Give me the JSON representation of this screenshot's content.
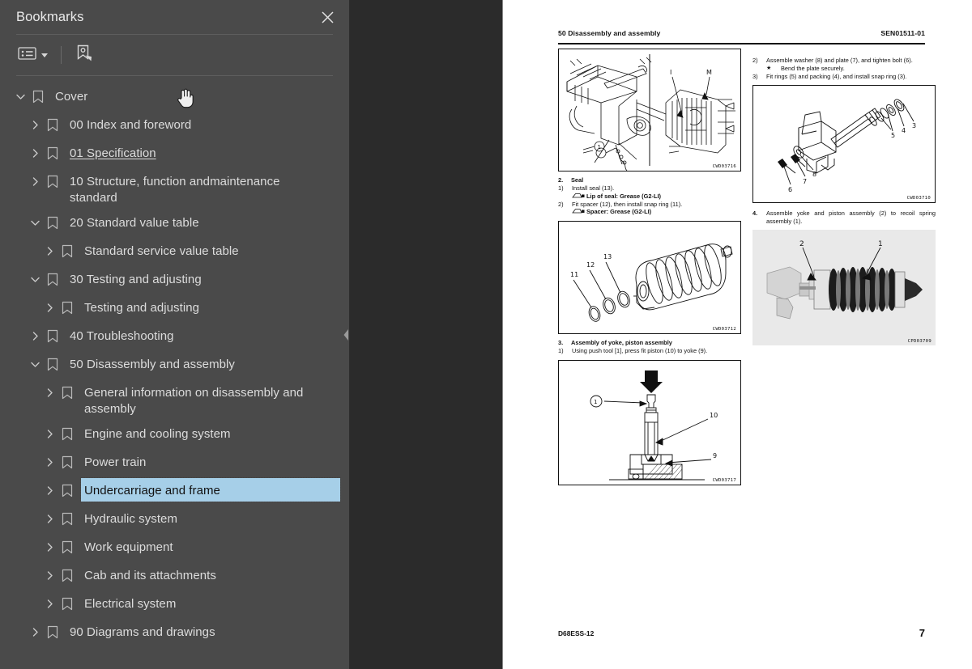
{
  "panel": {
    "title": "Bookmarks",
    "close_icon": "close-icon",
    "toolbar": {
      "list_options_label": "list-options",
      "list_options_icon": "bookmark-list-icon",
      "new_bookmark_icon": "new-bookmark-icon"
    }
  },
  "tree": [
    {
      "label": "Cover",
      "depth": 0,
      "state": "expanded",
      "selected": false,
      "underline": false
    },
    {
      "label": "00 Index and foreword",
      "depth": 1,
      "state": "collapsed",
      "selected": false,
      "underline": false
    },
    {
      "label": "01 Specification",
      "depth": 1,
      "state": "collapsed",
      "selected": false,
      "underline": true
    },
    {
      "label": "10 Structure, function andmaintenance standard",
      "depth": 1,
      "state": "collapsed",
      "selected": false,
      "underline": false
    },
    {
      "label": "20 Standard value table",
      "depth": 1,
      "state": "expanded",
      "selected": false,
      "underline": false
    },
    {
      "label": "Standard service value table",
      "depth": 2,
      "state": "collapsed",
      "selected": false,
      "underline": false
    },
    {
      "label": "30 Testing and adjusting",
      "depth": 1,
      "state": "expanded",
      "selected": false,
      "underline": false
    },
    {
      "label": "Testing and adjusting",
      "depth": 2,
      "state": "collapsed",
      "selected": false,
      "underline": false
    },
    {
      "label": "40 Troubleshooting",
      "depth": 1,
      "state": "collapsed",
      "selected": false,
      "underline": false
    },
    {
      "label": "50 Disassembly and assembly",
      "depth": 1,
      "state": "expanded",
      "selected": false,
      "underline": false
    },
    {
      "label": "General information on disassembly and assembly",
      "depth": 2,
      "state": "collapsed",
      "selected": false,
      "underline": false
    },
    {
      "label": "Engine and cooling system",
      "depth": 2,
      "state": "collapsed",
      "selected": false,
      "underline": false
    },
    {
      "label": "Power train",
      "depth": 2,
      "state": "collapsed",
      "selected": false,
      "underline": false
    },
    {
      "label": "Undercarriage and frame",
      "depth": 2,
      "state": "collapsed",
      "selected": true,
      "underline": false
    },
    {
      "label": "Hydraulic system",
      "depth": 2,
      "state": "collapsed",
      "selected": false,
      "underline": false
    },
    {
      "label": "Work equipment",
      "depth": 2,
      "state": "collapsed",
      "selected": false,
      "underline": false
    },
    {
      "label": "Cab and its attachments",
      "depth": 2,
      "state": "collapsed",
      "selected": false,
      "underline": false
    },
    {
      "label": "Electrical system",
      "depth": 2,
      "state": "collapsed",
      "selected": false,
      "underline": false
    },
    {
      "label": "90 Diagrams and drawings",
      "depth": 1,
      "state": "collapsed",
      "selected": false,
      "underline": false
    }
  ],
  "document": {
    "header_left": "50 Disassembly and assembly",
    "header_right": "SEN01511-01",
    "footer_left": "D68ESS-12",
    "footer_page": "7",
    "figures": {
      "fig1_code": "CWD03716",
      "fig2_code": "CWD03710",
      "fig3_code": "CWD03712",
      "fig4_code": "CPD03709",
      "fig5_code": "CWD03717"
    },
    "fig1_callouts": {
      "a": "I",
      "b": "M",
      "c": "1"
    },
    "fig2_callouts": [
      "3",
      "4",
      "5",
      "6",
      "7",
      "8"
    ],
    "fig3_callouts": [
      "11",
      "12",
      "13"
    ],
    "fig4_callouts": [
      "1",
      "2"
    ],
    "fig5_callouts": [
      "1",
      "10",
      "9"
    ],
    "text": {
      "step2_num": "2.",
      "step2_title": "Seal",
      "step2_1_num": "1)",
      "step2_1_body": "Install seal (13).",
      "step2_1_note": "Lip of seal: Grease (G2-LI)",
      "step2_2_num": "2)",
      "step2_2_body": "Fit spacer (12), then install snap ring (11).",
      "step2_2_note": "Spacer: Grease (G2-LI)",
      "step3_num": "3.",
      "step3_title": "Assembly of yoke, piston assembly",
      "step3_1_num": "1)",
      "step3_1_body": "Using push tool [1], press fit piston (10) to yoke (9).",
      "right_2_num": "2)",
      "right_2_body": "Assemble washer (8) and plate (7), and tighten bolt (6).",
      "right_2_star": "★",
      "right_2_star_body": "Bend the plate securely.",
      "right_3_num": "3)",
      "right_3_body": "Fit rings (5) and packing (4), and install snap ring (3).",
      "right_4_num": "4.",
      "right_4_body": "Assemble yoke and piston assembly (2) to recoil spring assembly (1)."
    }
  },
  "colors": {
    "panel_bg": "#4a4a4a",
    "gutter_bg": "#2b2b2b",
    "selection": "#a6cfe8",
    "page_bg": "#ffffff",
    "text": "#dcdcdc"
  }
}
